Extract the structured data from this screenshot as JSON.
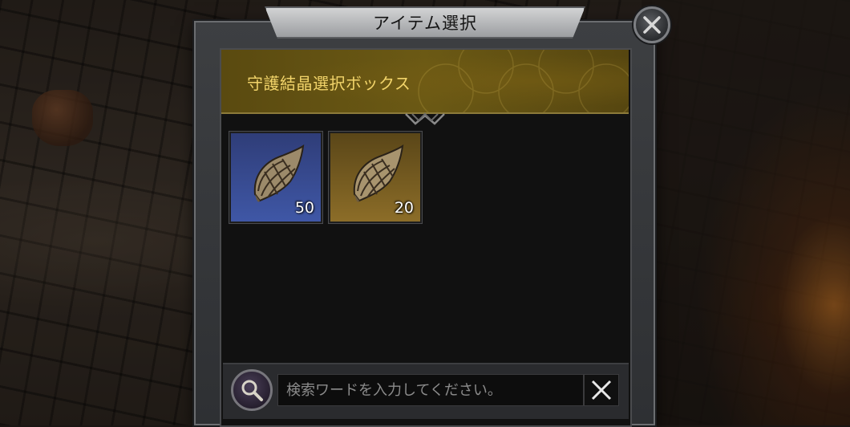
{
  "dialog": {
    "title": "アイテム選択",
    "header": "守護結晶選択ボックス"
  },
  "items": [
    {
      "icon": "armor-plate-icon",
      "count": "50",
      "rarity_color": "#3f57a6"
    },
    {
      "icon": "armor-plate-icon",
      "count": "20",
      "rarity_color": "#8c6d28"
    }
  ],
  "search": {
    "placeholder": "検索ワードを入力してください。",
    "value": ""
  },
  "colors": {
    "header_text": "#f2d46a",
    "header_bg": "#6b5914",
    "panel_bg": "#111111"
  }
}
